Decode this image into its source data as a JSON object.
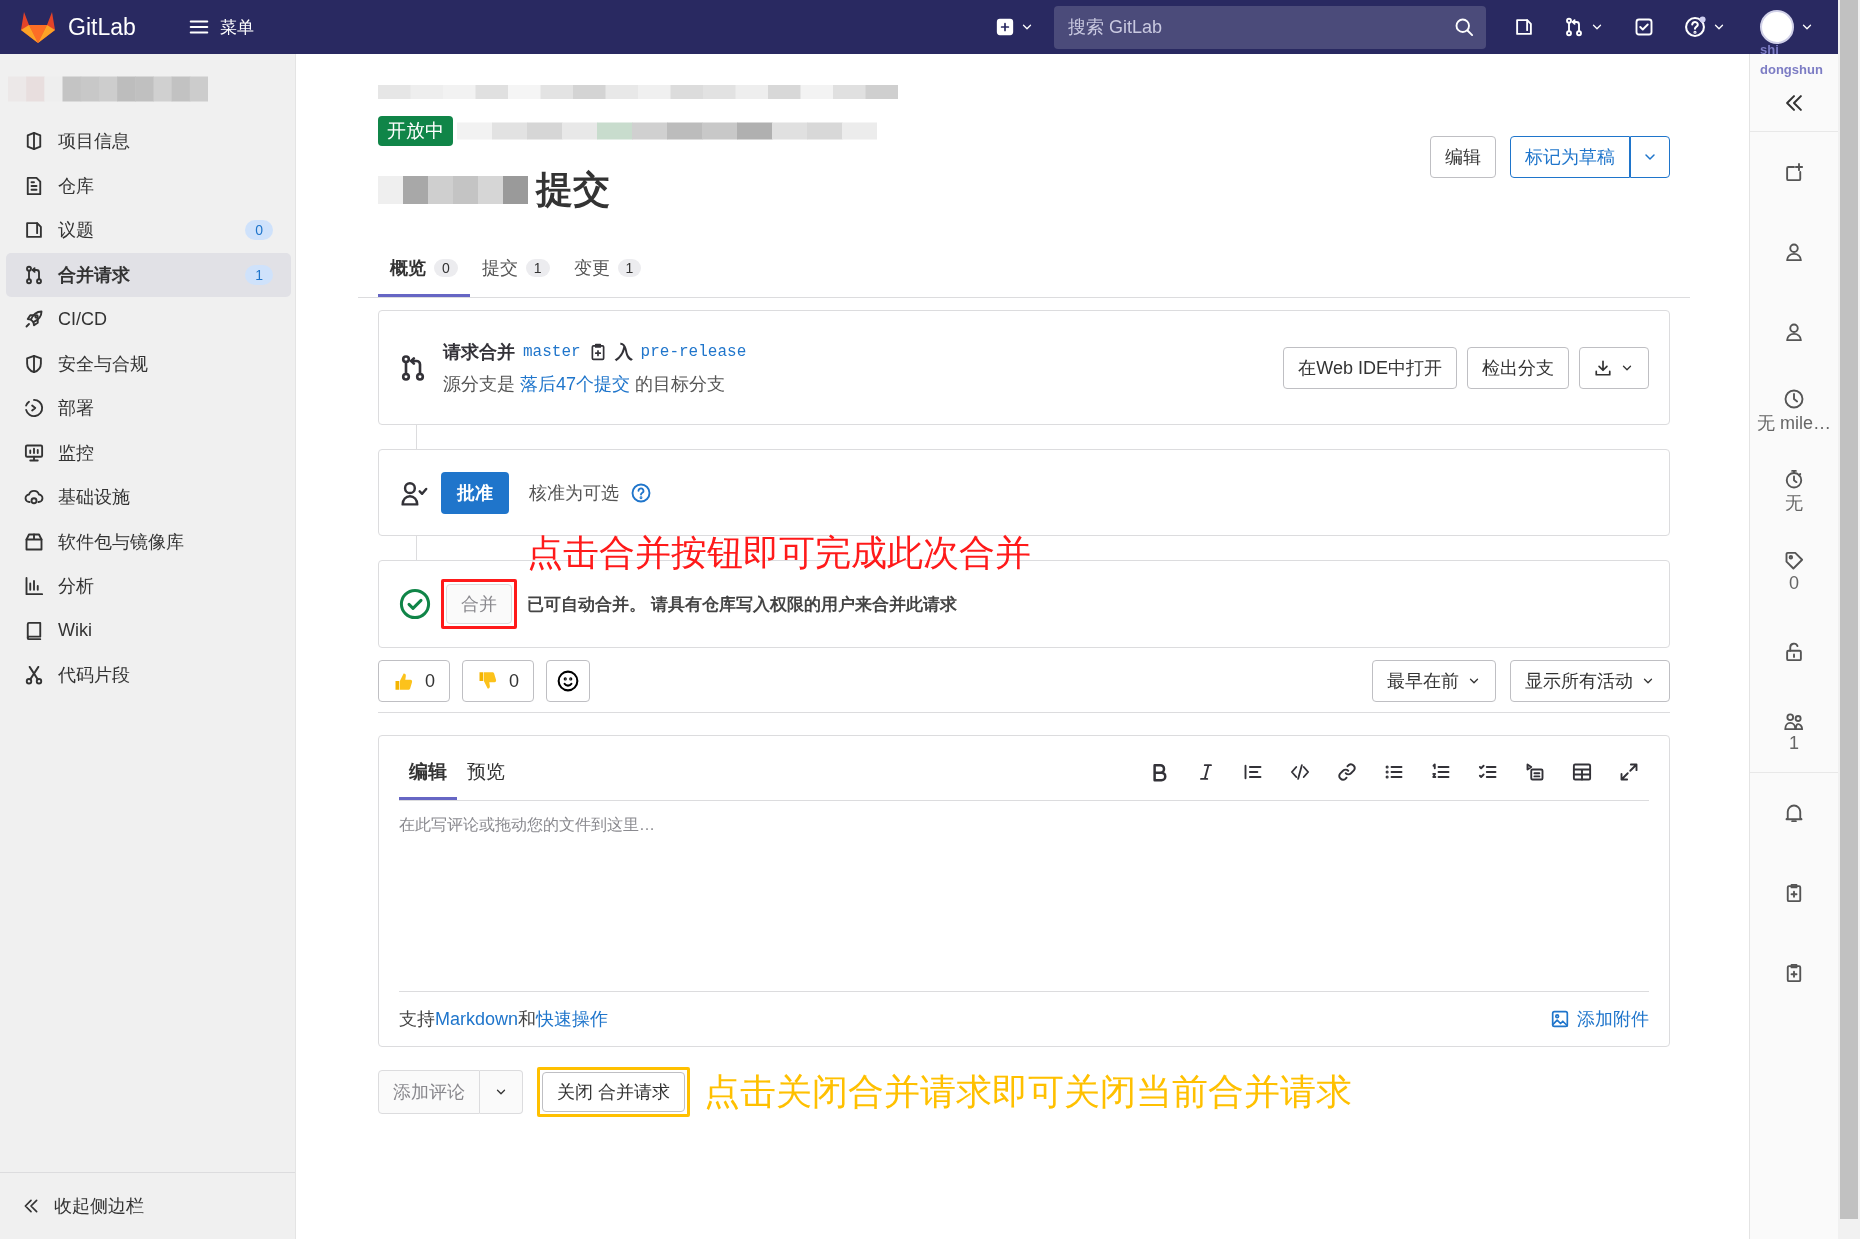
{
  "top_bar": {
    "brand": "GitLab",
    "menu_label": "菜单",
    "search": {
      "placeholder": "搜索 GitLab"
    },
    "avatar_alt": "shi dongshun"
  },
  "sidebar": {
    "items": [
      {
        "label": "项目信息",
        "selected": false
      },
      {
        "label": "仓库",
        "selected": false
      },
      {
        "label": "议题",
        "count": "0",
        "selected": false
      },
      {
        "label": "合并请求",
        "count": "1",
        "selected": true
      },
      {
        "label": "CI/CD",
        "selected": false
      },
      {
        "label": "安全与合规",
        "selected": false
      },
      {
        "label": "部署",
        "selected": false
      },
      {
        "label": "监控",
        "selected": false
      },
      {
        "label": "基础设施",
        "selected": false
      },
      {
        "label": "软件包与镜像库",
        "selected": false
      },
      {
        "label": "分析",
        "selected": false
      },
      {
        "label": "Wiki",
        "selected": false
      },
      {
        "label": "代码片段",
        "selected": false
      }
    ],
    "collapse_label": "收起侧边栏"
  },
  "merge_request": {
    "state_badge": "开放中",
    "title": "提交",
    "edit_button": "编辑",
    "draft_button": "标记为草稿",
    "tabs": [
      {
        "label": "概览",
        "count": "0",
        "selected": true
      },
      {
        "label": "提交",
        "count": "1",
        "selected": false
      },
      {
        "label": "变更",
        "count": "1",
        "selected": false
      }
    ],
    "widget": {
      "request_label": "请求合并",
      "source_branch": "master",
      "into_label": "入",
      "target_branch": "pre-release",
      "status": {
        "prefix": "源分支是 ",
        "link": "落后47个提交",
        "suffix": " 的目标分支"
      },
      "buttons": [
        "在Web IDE中打开",
        "检出分支"
      ]
    },
    "approval": {
      "button": "批准",
      "note": "核准为可选"
    },
    "merge": {
      "button": "合并",
      "disabled": true,
      "message": "已可自动合并。 请具有仓库写入权限的用户来合并此请求"
    },
    "reactions": [
      {
        "kind": "thumbs_up",
        "count": "0"
      },
      {
        "kind": "thumbs_down",
        "count": "0"
      }
    ],
    "filters": [
      "最早在前",
      "显示所有活动"
    ],
    "editor": {
      "tabs": [
        {
          "label": "编辑",
          "selected": true
        },
        {
          "label": "预览",
          "selected": false
        }
      ],
      "placeholder": "在此写评论或拖动您的文件到这里…",
      "hint": {
        "prefix": "支持",
        "markdown_link": "Markdown",
        "joiner": "和",
        "quick_actions_link": "快速操作"
      },
      "attach": "添加附件"
    },
    "comment_button": {
      "label": "添加评论",
      "disabled": true
    },
    "close_button": "关闭 合并请求",
    "annotations": [
      {
        "text": "点击合并按钮即可完成此次合并",
        "color": "#ff1a1a"
      },
      {
        "text": "点击关闭合并请求即可关闭当前合并请求",
        "color": "#ffc000"
      }
    ]
  },
  "right_sidebar": {
    "items": [
      {
        "kind": "todo"
      },
      {
        "kind": "assignee"
      },
      {
        "kind": "reviewer"
      },
      {
        "kind": "milestone",
        "text": "无 mile…"
      },
      {
        "kind": "time",
        "text": "无"
      },
      {
        "kind": "labels",
        "text": "0"
      },
      {
        "kind": "lock"
      },
      {
        "kind": "participants",
        "text": "1"
      },
      {
        "kind": "notifications"
      },
      {
        "kind": "copy"
      },
      {
        "kind": "copy"
      }
    ]
  }
}
